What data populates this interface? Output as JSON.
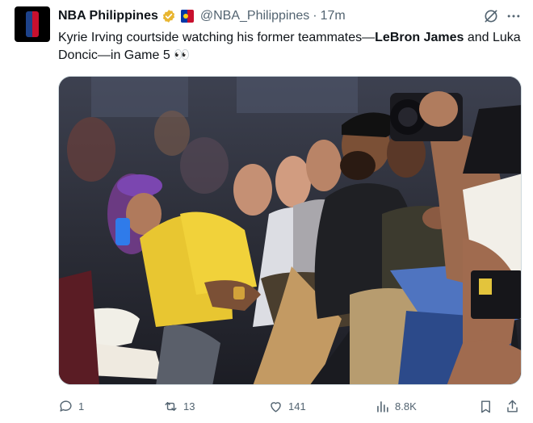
{
  "tweet": {
    "display_name": "NBA Philippines",
    "handle": "@NBA_Philippines",
    "separator": "·",
    "time": "17m",
    "text_part1": "Kyrie Irving courtside watching his former teammates—",
    "text_bold": "LeBron James",
    "text_part2": " and Luka Doncic—in Game 5 👀"
  },
  "actions": {
    "replies": "1",
    "reposts": "13",
    "likes": "141",
    "views": "8.8K"
  },
  "icons": [
    "nba-logo",
    "verified-badge",
    "flag-badge",
    "grok-icon",
    "more-icon",
    "reply-icon",
    "repost-icon",
    "like-icon",
    "views-icon",
    "bookmark-icon",
    "share-icon"
  ],
  "colors": {
    "verified": "#e8b52f",
    "secondary_text": "#536471",
    "primary_text": "#0f1419"
  }
}
